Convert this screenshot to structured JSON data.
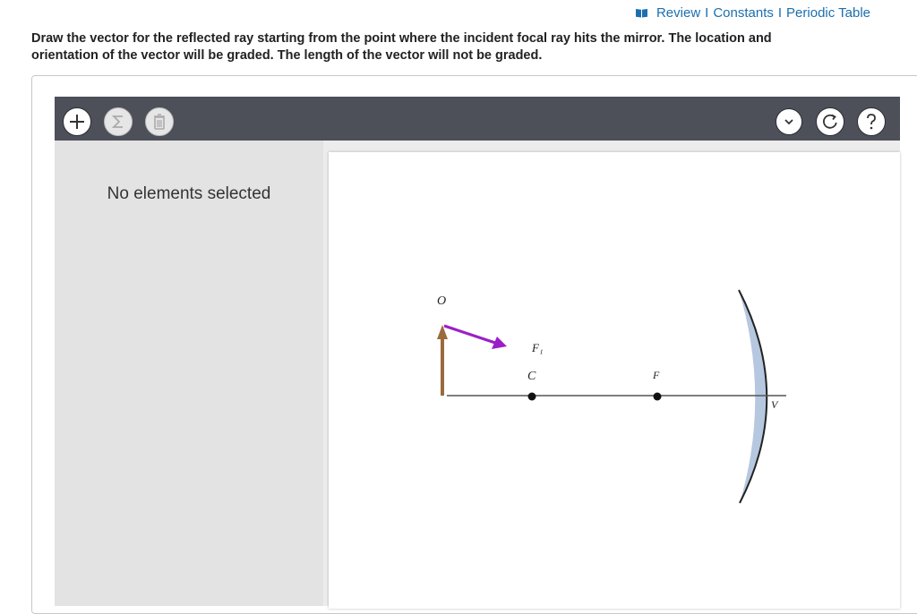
{
  "links": {
    "review": "Review",
    "constants": "Constants",
    "periodic_table": "Periodic Table",
    "separator": "I"
  },
  "instructions": "Draw the vector for the reflected ray starting from the point where the incident focal ray hits the mirror. The location and orientation of the vector will be graded. The length of the vector will not be graded.",
  "sidebar": {
    "message": "No elements selected"
  },
  "diagram": {
    "labels": {
      "object": "O",
      "image_point": "F₁",
      "center": "C",
      "focus": "F",
      "vertex": "V"
    }
  },
  "colors": {
    "link": "#1b6fae",
    "toolbar": "#4d4f59",
    "object_arrow": "#9b6a3d",
    "vector": "#9b1fc8",
    "mirror": "#b6c7e0",
    "axis": "#555555"
  },
  "icons": {
    "add": "plus-icon",
    "sum": "sigma-icon",
    "delete": "trash-icon",
    "menu": "chevron-down-icon",
    "reset": "reset-icon",
    "help": "question-icon",
    "links": "book-icon"
  }
}
